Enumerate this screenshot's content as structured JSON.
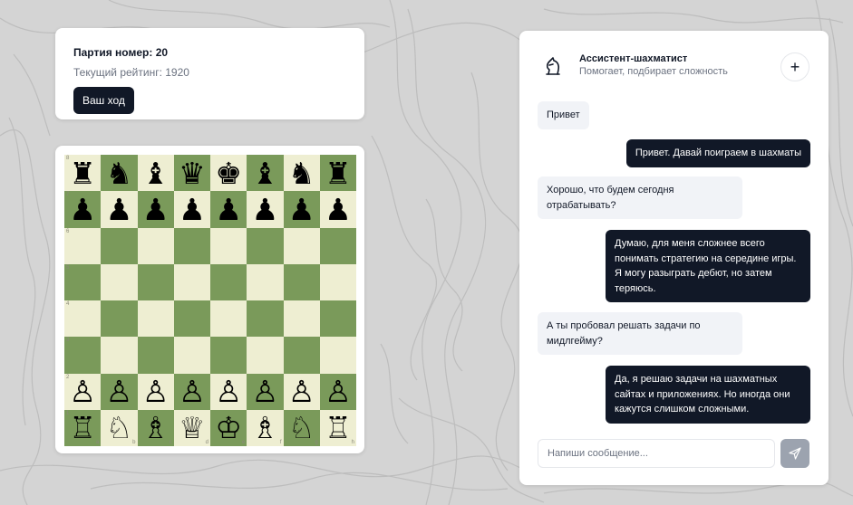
{
  "game": {
    "title": "Партия номер: 20",
    "rating": "Текущий рейтинг: 1920",
    "turn_button": "Ваш ход"
  },
  "board": {
    "ranks": [
      "8",
      "7",
      "6",
      "5",
      "4",
      "3",
      "2",
      "1"
    ],
    "files": [
      "a",
      "b",
      "c",
      "d",
      "e",
      "f",
      "g",
      "h"
    ],
    "rows": [
      [
        "♜",
        "♞",
        "♝",
        "♛",
        "♚",
        "♝",
        "♞",
        "♜"
      ],
      [
        "♟",
        "♟",
        "♟",
        "♟",
        "♟",
        "♟",
        "♟",
        "♟"
      ],
      [
        "",
        "",
        "",
        "",
        "",
        "",
        "",
        ""
      ],
      [
        "",
        "",
        "",
        "",
        "",
        "",
        "",
        ""
      ],
      [
        "",
        "",
        "",
        "",
        "",
        "",
        "",
        ""
      ],
      [
        "",
        "",
        "",
        "",
        "",
        "",
        "",
        ""
      ],
      [
        "♙",
        "♙",
        "♙",
        "♙",
        "♙",
        "♙",
        "♙",
        "♙"
      ],
      [
        "♖",
        "♘",
        "♗",
        "♕",
        "♔",
        "♗",
        "♘",
        "♖"
      ]
    ],
    "light_color": "#eeeed2",
    "dark_color": "#7a9a5a"
  },
  "chat": {
    "title": "Ассистент-шахматист",
    "subtitle": "Помогает, подбирает сложность",
    "plus_label": "+",
    "logo_icon": "chess-knight-icon",
    "messages": [
      {
        "role": "bot",
        "text": "Привет"
      },
      {
        "role": "user",
        "text": "Привет. Давай поиграем в шахматы"
      },
      {
        "role": "bot",
        "text": "Хорошо, что будем сегодня отрабатывать?"
      },
      {
        "role": "user",
        "text": "Думаю, для меня сложнее всего понимать стратегию на середине игры. Я могу разыграть дебют, но затем теряюсь."
      },
      {
        "role": "bot",
        "text": "А ты пробовал решать задачи по мидлгейму?"
      },
      {
        "role": "user",
        "text": "Да, я решаю задачи на шахматных сайтах и приложениях. Но иногда они кажутся слишком сложными."
      }
    ],
    "input_placeholder": "Напиши сообщение...",
    "send_icon": "send-icon"
  },
  "colors": {
    "accent": "#111827",
    "muted": "#6b7280",
    "bot_bubble": "#f1f3f7",
    "send_disabled": "#9ca3af"
  }
}
